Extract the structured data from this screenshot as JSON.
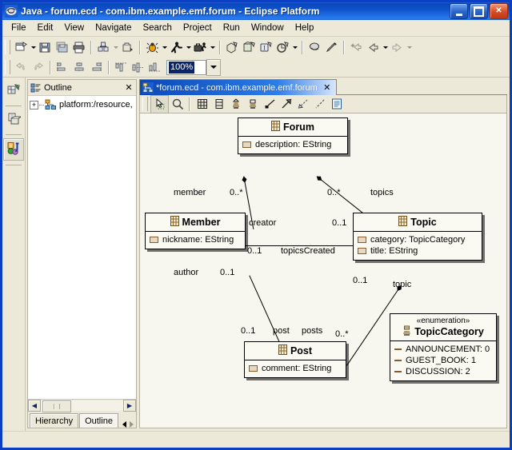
{
  "window": {
    "title": "Java - forum.ecd - com.ibm.example.emf.forum - Eclipse Platform",
    "app_icon": "eclipse-icon",
    "minimize_label": "_",
    "maximize_label": "□",
    "close_label": "✕"
  },
  "menu": [
    {
      "label": "File",
      "mnemonic": "F"
    },
    {
      "label": "Edit",
      "mnemonic": "E"
    },
    {
      "label": "View",
      "mnemonic": "V"
    },
    {
      "label": "Navigate",
      "mnemonic": "N"
    },
    {
      "label": "Search",
      "mnemonic": "a"
    },
    {
      "label": "Project",
      "mnemonic": "P"
    },
    {
      "label": "Run",
      "mnemonic": "R"
    },
    {
      "label": "Window",
      "mnemonic": "W"
    },
    {
      "label": "Help",
      "mnemonic": "H"
    }
  ],
  "toolbar_row1": [
    {
      "name": "new-wizard-button",
      "icon": "new-file-icon",
      "dropdown": true
    },
    {
      "name": "save-button",
      "icon": "save-icon",
      "dropdown": false
    },
    {
      "name": "save-all-button",
      "icon": "save-all-icon",
      "dropdown": false
    },
    {
      "name": "print-button",
      "icon": "print-icon",
      "dropdown": false
    },
    {
      "name": "build-button",
      "icon": "build-icon",
      "dropdown": true
    },
    {
      "name": "export-button",
      "icon": "export-icon",
      "dropdown": false
    },
    {
      "name": "debug-button",
      "icon": "debug-bug-icon",
      "dropdown": true
    },
    {
      "name": "run-button",
      "icon": "run-person-icon",
      "dropdown": true
    },
    {
      "name": "external-tools-button",
      "icon": "toolbox-icon",
      "dropdown": true
    },
    {
      "name": "new-java-package-button",
      "icon": "new-package-icon",
      "dropdown": false
    },
    {
      "name": "new-java-class-button",
      "icon": "new-class-icon",
      "dropdown": false
    },
    {
      "name": "new-java-interface-button",
      "icon": "new-interface-icon",
      "dropdown": false
    },
    {
      "name": "new-java-project-button",
      "icon": "new-project-icon",
      "dropdown": true
    },
    {
      "name": "search-button",
      "icon": "search-icon",
      "dropdown": false
    },
    {
      "name": "annotation-button",
      "icon": "pen-icon",
      "dropdown": false
    },
    {
      "name": "last-edit-location-button",
      "icon": "last-edit-icon",
      "dropdown": false
    },
    {
      "name": "back-button",
      "icon": "back-arrow-icon",
      "dropdown": true
    },
    {
      "name": "forward-button",
      "icon": "forward-arrow-icon",
      "dropdown": true
    }
  ],
  "toolbar_row2": [
    {
      "name": "undo-button",
      "icon": "undo-icon"
    },
    {
      "name": "redo-button",
      "icon": "redo-icon"
    },
    {
      "name": "align-left-button",
      "icon": "align-left-icon"
    },
    {
      "name": "align-center-button",
      "icon": "align-center-icon"
    },
    {
      "name": "align-right-button",
      "icon": "align-right-icon"
    },
    {
      "name": "align-top-button",
      "icon": "align-top-icon"
    },
    {
      "name": "align-middle-button",
      "icon": "align-middle-icon"
    },
    {
      "name": "align-bottom-button",
      "icon": "align-bottom-icon"
    }
  ],
  "zoom": {
    "value": "100%",
    "name": "zoom-combo"
  },
  "fastview": [
    {
      "name": "fastview-package-explorer",
      "icon": "package-explorer-icon",
      "selected": false
    },
    {
      "name": "fastview-resource",
      "icon": "resource-icon",
      "selected": false
    },
    {
      "name": "fastview-java-perspective",
      "icon": "java-perspective-icon",
      "selected": true
    }
  ],
  "outline_view": {
    "tab_label": "Outline",
    "tab_icon": "outline-icon",
    "close_label": "✕",
    "tree": [
      {
        "label": "platform:/resource,",
        "icon": "model-tree-icon",
        "expander": "+"
      }
    ],
    "bottom_tabs": [
      {
        "label": "Hierarchy",
        "active": false
      },
      {
        "label": "Outline",
        "active": true
      }
    ]
  },
  "editor": {
    "tab_label": "*forum.ecd - com.ibm.example.emf.forum",
    "tab_icon": "ecore-diagram-icon",
    "close_label": "✕",
    "palette": [
      {
        "name": "select-tool",
        "icon": "select-pointer-icon",
        "selected": true
      },
      {
        "name": "zoom-tool",
        "icon": "magnifier-icon"
      },
      {
        "name": "eclass-tool",
        "icon": "eclass-icon"
      },
      {
        "name": "eattribute-tool",
        "icon": "eattribute-icon"
      },
      {
        "name": "einterface-tool",
        "icon": "einterface-icon"
      },
      {
        "name": "eenum-tool",
        "icon": "eenum-icon"
      },
      {
        "name": "association-tool",
        "icon": "association-line-icon"
      },
      {
        "name": "generalization-tool",
        "icon": "generalization-arrow-icon"
      },
      {
        "name": "dependency-tool",
        "icon": "dependency-arrow-icon"
      },
      {
        "name": "link-tool",
        "icon": "link-dashed-icon"
      },
      {
        "name": "note-tool",
        "icon": "note-icon"
      }
    ]
  },
  "diagram": {
    "classes": [
      {
        "id": "forum",
        "name": "Forum",
        "icon": "eclass-icon",
        "features": [
          {
            "label": "description: EString",
            "kind": "attribute"
          }
        ]
      },
      {
        "id": "member",
        "name": "Member",
        "icon": "eclass-icon",
        "features": [
          {
            "label": "nickname: EString",
            "kind": "attribute"
          }
        ]
      },
      {
        "id": "topic",
        "name": "Topic",
        "icon": "eclass-icon",
        "features": [
          {
            "label": "category: TopicCategory",
            "kind": "attribute"
          },
          {
            "label": "title: EString",
            "kind": "attribute"
          }
        ]
      },
      {
        "id": "post",
        "name": "Post",
        "icon": "eclass-icon",
        "features": [
          {
            "label": "comment: EString",
            "kind": "attribute"
          }
        ]
      }
    ],
    "enumeration": {
      "id": "topiccategory",
      "stereotype": "«enumeration»",
      "name": "TopicCategory",
      "icon": "eenum-icon",
      "literals": [
        {
          "label": "ANNOUNCEMENT: 0"
        },
        {
          "label": "GUEST_BOOK: 1"
        },
        {
          "label": "DISCUSSION: 2"
        }
      ]
    },
    "edge_labels": [
      {
        "id": "member-role",
        "text": "member"
      },
      {
        "id": "member-mult",
        "text": "0..*"
      },
      {
        "id": "topics-mult",
        "text": "0..*"
      },
      {
        "id": "topics-role",
        "text": "topics"
      },
      {
        "id": "creator-role",
        "text": "creator"
      },
      {
        "id": "creator-mult",
        "text": "0..1"
      },
      {
        "id": "topicscreated-mult",
        "text": "0..1"
      },
      {
        "id": "topicscreated-role",
        "text": "topicsCreated"
      },
      {
        "id": "author-role",
        "text": "author"
      },
      {
        "id": "author-mult",
        "text": "0..1"
      },
      {
        "id": "topic-mult",
        "text": "0..1"
      },
      {
        "id": "topic-role",
        "text": "topic"
      },
      {
        "id": "post-mult",
        "text": "0..1"
      },
      {
        "id": "post-role",
        "text": "post"
      },
      {
        "id": "posts-role",
        "text": "posts"
      },
      {
        "id": "posts-mult",
        "text": "0..*"
      }
    ]
  },
  "statusbar": {
    "text": ""
  },
  "colors": {
    "title_blue": "#0a47b8",
    "chrome": "#ece9d8",
    "canvas": "#f7f6ef",
    "node_fill": "#fbfaf2",
    "selection_blue": "#0a246a",
    "attr_brown": "#8a5a2b"
  }
}
